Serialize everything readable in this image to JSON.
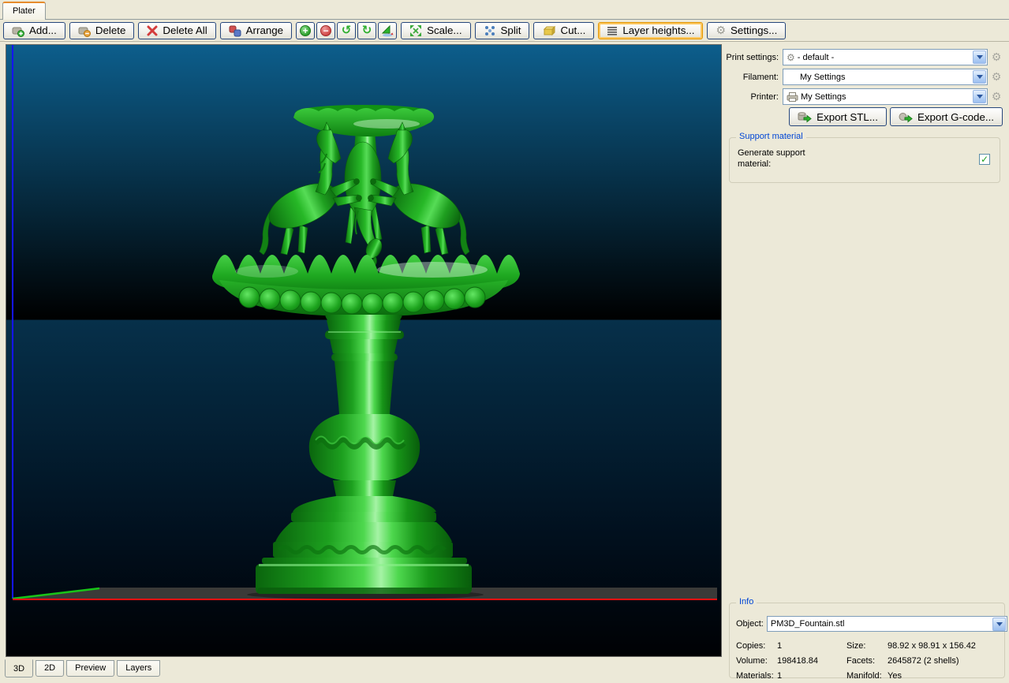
{
  "window": {
    "tab_label": "Plater"
  },
  "toolbar": {
    "add": "Add...",
    "delete": "Delete",
    "delete_all": "Delete All",
    "arrange": "Arrange",
    "scale": "Scale...",
    "split": "Split",
    "cut": "Cut...",
    "layer_heights": "Layer heights...",
    "settings": "Settings..."
  },
  "icons": {
    "gear": "⚙",
    "rotate_ccw": "↺",
    "rotate_cw": "↻",
    "plus": "+",
    "minus": "−",
    "check": "✓"
  },
  "sidebar": {
    "print_settings_label": "Print settings:",
    "print_settings_value": "- default -",
    "filament_label": "Filament:",
    "filament_value": "My Settings",
    "printer_label": "Printer:",
    "printer_value": "My Settings",
    "export_stl": "Export STL...",
    "export_gcode": "Export G-code...",
    "support": {
      "title": "Support material",
      "generate_label": "Generate support material:",
      "checked": true
    },
    "info": {
      "title": "Info",
      "object_label": "Object:",
      "object_value": "PM3D_Fountain.stl",
      "copies_label": "Copies:",
      "copies": "1",
      "size_label": "Size:",
      "size": "98.92 x 98.91 x 156.42",
      "volume_label": "Volume:",
      "volume": "198418.84",
      "facets_label": "Facets:",
      "facets": "2645872 (2 shells)",
      "materials_label": "Materials:",
      "materials": "1",
      "manifold_label": "Manifold:",
      "manifold": "Yes"
    }
  },
  "viewport": {
    "tabs": [
      "3D",
      "2D",
      "Preview",
      "Layers"
    ],
    "active_tab": "3D",
    "model": "PM3D_Fountain.stl",
    "model_color": "#1fa41f",
    "bg_top": "#0d5e8c",
    "bg_bottom": "#000104",
    "axis_x_color": "#ff1010",
    "axis_y_color": "#18c418",
    "axis_z_color": "#1414ff"
  }
}
